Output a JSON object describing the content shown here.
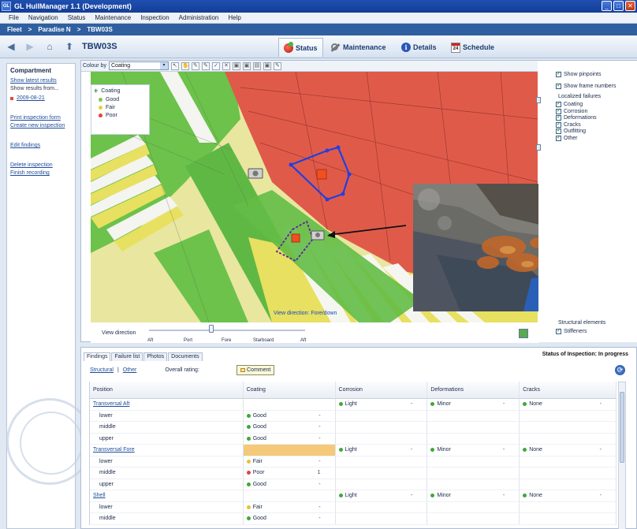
{
  "window": {
    "logo": "GL",
    "title": "GL HullManager 1.1 (Development)",
    "minimize": "_",
    "maximize": "□",
    "close": "✕"
  },
  "menu": [
    "File",
    "Navigation",
    "Status",
    "Maintenance",
    "Inspection",
    "Administration",
    "Help"
  ],
  "breadcrumb": [
    "Fleet",
    ">",
    "Paradise N",
    ">",
    "TBW03S"
  ],
  "toolbar": {
    "back": "◀",
    "forward": "▶",
    "home": "⌂",
    "up": "⬆",
    "page_title": "TBW03S",
    "tabs": [
      {
        "label": "Status",
        "icon": "status-icon"
      },
      {
        "label": "Maintenance",
        "icon": "wrench-icon"
      },
      {
        "label": "Details",
        "icon": "info-icon"
      },
      {
        "label": "Schedule",
        "icon": "calendar-icon",
        "cal_text": "24"
      }
    ]
  },
  "sidebar": {
    "heading": "Compartment",
    "show_latest": "Show latest results",
    "show_from": "Show results from...",
    "date": "2009-08-21",
    "links": [
      "Print inspection form",
      "Create new inspection",
      "Edit findings",
      "Delete inspection",
      "Finish recording"
    ]
  },
  "viewer": {
    "colour_label": "Colour by",
    "colour_value": "Coating",
    "colour_arrow": "▾",
    "tool_glyphs": [
      "↖",
      "✋",
      "✎",
      "✎",
      "✓",
      "✕",
      "▣",
      "▣",
      "▤",
      "▣",
      "✎"
    ],
    "legend_title": "Coating",
    "legend_plus": "+",
    "legend": [
      {
        "label": "Good",
        "color": "#7ec850"
      },
      {
        "label": "Fair",
        "color": "#e6d23a"
      },
      {
        "label": "Poor",
        "color": "#e0453a"
      }
    ],
    "view_direction_overlay": "View direction: Fore/down",
    "view_direction_label": "View direction",
    "slider_value": 0.4,
    "ticks": [
      "Aft",
      "Port",
      "Fore",
      "Starboard",
      "Aft"
    ]
  },
  "filters": {
    "show_pinpoints": "Show pinpoints",
    "show_frames": "Show frame numbers",
    "localized_title": "Localized failures",
    "localized": [
      "Coating",
      "Corrosion",
      "Deformations",
      "Cracks",
      "Outfitting",
      "Other"
    ],
    "structural_title": "Structural elements",
    "structural": [
      "Stiffeners"
    ]
  },
  "bottom": {
    "tabs": [
      "Findings",
      "Failure list",
      "Photos",
      "Documents"
    ],
    "status": "Status of Inspection: In progress",
    "structural": "Structural",
    "separator": "|",
    "other": "Other",
    "overall": "Overall rating:",
    "comment": "Comment",
    "refresh": "⟳",
    "columns": [
      "Position",
      "Coating",
      "Corrosion",
      "Deformations",
      "Cracks"
    ],
    "dash": "-",
    "rows": [
      {
        "type": "group",
        "position": "Transversal Aft",
        "coating": "",
        "corrosion": "Light",
        "deformations": "Minor",
        "cracks": "None",
        "highlight": false
      },
      {
        "type": "sub",
        "position": "lower",
        "coating": "Good",
        "coating_color": "#3fa83a",
        "count": "-"
      },
      {
        "type": "sub",
        "position": "middle",
        "coating": "Good",
        "coating_color": "#3fa83a",
        "count": "-"
      },
      {
        "type": "sub",
        "position": "upper",
        "coating": "Good",
        "coating_color": "#3fa83a",
        "count": "-"
      },
      {
        "type": "group",
        "position": "Transversal Fore",
        "coating": "",
        "corrosion": "Light",
        "deformations": "Minor",
        "cracks": "None",
        "highlight": true
      },
      {
        "type": "sub",
        "position": "lower",
        "coating": "Fair",
        "coating_color": "#e6c23a",
        "count": "-"
      },
      {
        "type": "sub",
        "position": "middle",
        "coating": "Poor",
        "coating_color": "#e0453a",
        "count": "1"
      },
      {
        "type": "sub",
        "position": "upper",
        "coating": "Good",
        "coating_color": "#3fa83a",
        "count": "-"
      },
      {
        "type": "group",
        "position": "Shell",
        "coating": "",
        "corrosion": "Light",
        "deformations": "Minor",
        "cracks": "None",
        "highlight": false
      },
      {
        "type": "sub",
        "position": "lower",
        "coating": "Fair",
        "coating_color": "#e6c23a",
        "count": "-"
      },
      {
        "type": "sub",
        "position": "middle",
        "coating": "Good",
        "coating_color": "#3fa83a",
        "count": "-"
      }
    ],
    "status_dot_colors": {
      "Light": "#3fa83a",
      "Minor": "#3fa83a",
      "None": "#3fa83a"
    }
  }
}
